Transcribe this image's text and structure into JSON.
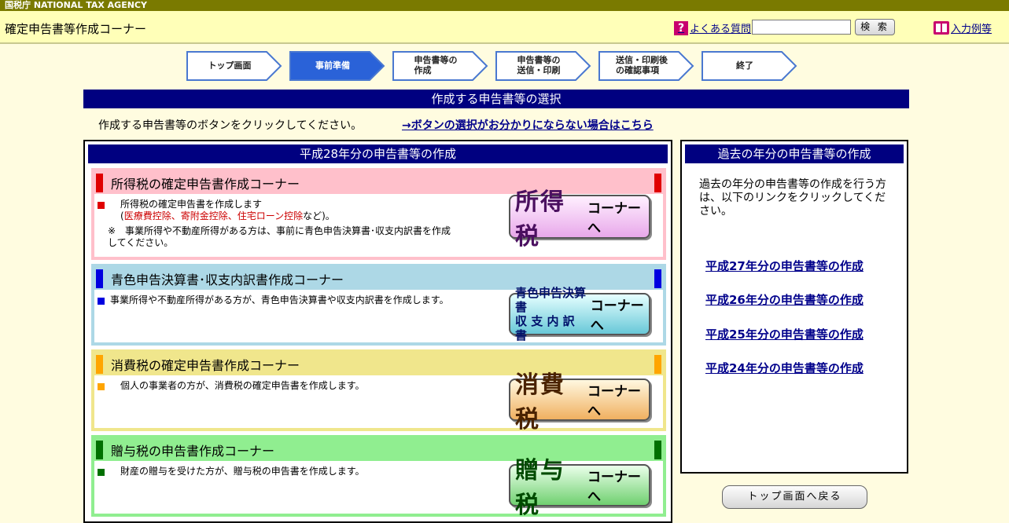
{
  "agency_label": "国税庁  NATIONAL TAX AGENCY",
  "header": {
    "title": "確定申告書等作成コーナー",
    "faq_label": "よくある質問",
    "search_value": "",
    "search_button": "検 索",
    "example_label": "入力例等"
  },
  "steps": [
    {
      "label": "トップ画面",
      "active": false
    },
    {
      "label": "事前準備",
      "active": true
    },
    {
      "label": "申告書等の\n作成",
      "active": false
    },
    {
      "label": "申告書等の\n送信・印刷",
      "active": false
    },
    {
      "label": "送信・印刷後\nの確認事項",
      "active": false
    },
    {
      "label": "終了",
      "active": false
    }
  ],
  "section_title": "作成する申告書等の選択",
  "instruction": "作成する申告書等のボタンをクリックしてください。",
  "help_link": "→ボタンの選択がお分かりにならない場合はこちら",
  "main_box": {
    "title": "平成28年分の申告書等の作成",
    "corners": [
      {
        "title": "所得税の確定申告書作成コーナー",
        "line1": "所得税の確定申告書を作成します",
        "line2_paren_open": "(",
        "line2_red": "医療費控除、寄附金控除、住宅ローン控除",
        "line2_after": "など)。",
        "note": "※　事業所得や不動産所得がある方は、事前に青色申告決算書･収支内訳書を作成してください。",
        "button_big": "所得税",
        "button_small": "コーナーへ"
      },
      {
        "title": "青色申告決算書･収支内訳書作成コーナー",
        "line1": "事業所得や不動産所得がある方が、青色申告決算書や収支内訳書を作成します。",
        "button_line1": "青色申告決算書",
        "button_line2": "収 支 内 訳 書",
        "button_small": "コーナーへ"
      },
      {
        "title": "消費税の確定申告書作成コーナー",
        "line1": "個人の事業者の方が、消費税の確定申告書を作成します。",
        "button_big": "消費税",
        "button_small": "コーナーへ"
      },
      {
        "title": "贈与税の申告書作成コーナー",
        "line1": "財産の贈与を受けた方が、贈与税の申告書を作成します。",
        "button_big": "贈与税",
        "button_small": "コーナーへ"
      }
    ]
  },
  "past_box": {
    "title": "過去の年分の申告書等の作成",
    "description": "過去の年分の申告書等の作成を行う方は、以下のリンクをクリックしてください。",
    "links": [
      "平成27年分の申告書等の作成",
      "平成26年分の申告書等の作成",
      "平成25年分の申告書等の作成",
      "平成24年分の申告書等の作成"
    ]
  },
  "back_button": "トップ画面へ戻る",
  "colors": {
    "navy": "#000080",
    "shotoku": "#ffc0cb",
    "aoiro": "#add8e6",
    "shohi": "#f0e68c",
    "zoyo": "#90ee90"
  }
}
